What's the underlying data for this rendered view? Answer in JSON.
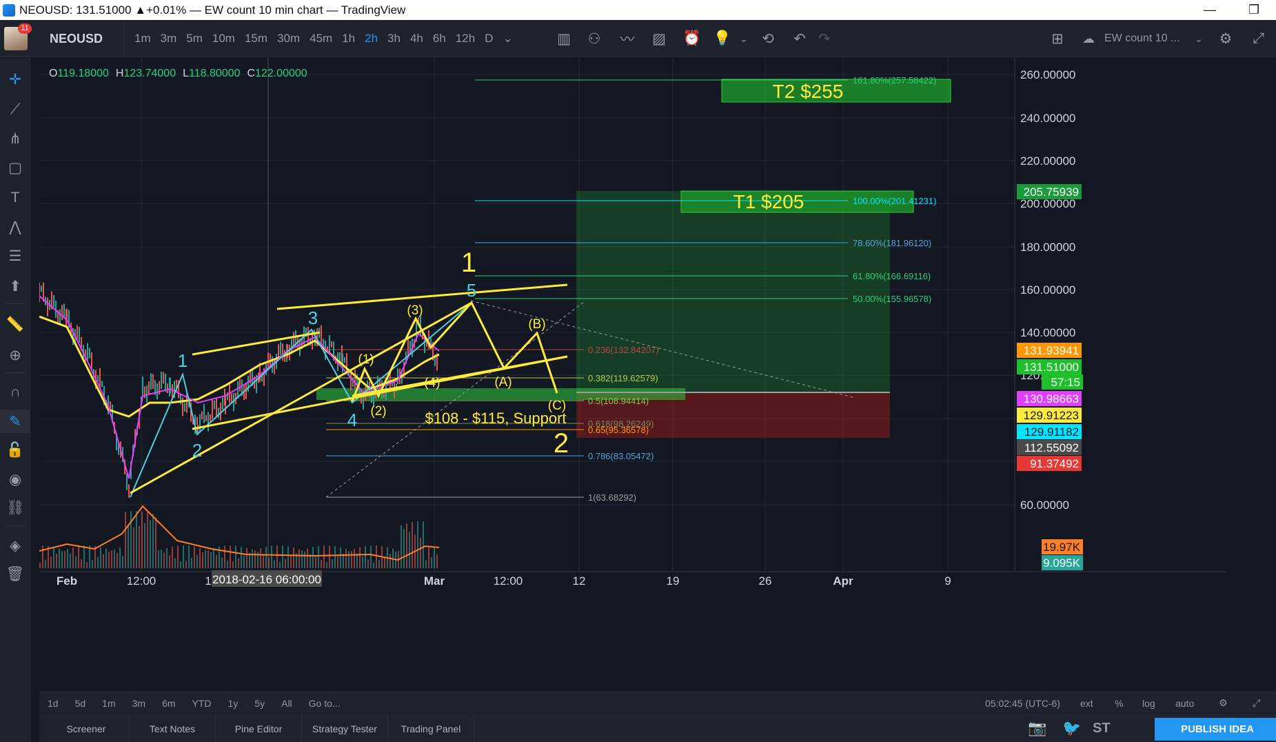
{
  "window": {
    "title": "NEOUSD: 131.51000 ▲+0.01% — EW count 10 min chart — TradingView",
    "minimize": "—",
    "restore": "❐"
  },
  "toolbar": {
    "avatar_badge": "11",
    "symbol": "NEOUSD",
    "intervals": [
      "1m",
      "3m",
      "5m",
      "10m",
      "15m",
      "30m",
      "45m",
      "1h",
      "2h",
      "3h",
      "4h",
      "6h",
      "12h",
      "D"
    ],
    "active_interval": "2h",
    "layout_name": "EW count 10 ...",
    "dropdown": "⌄"
  },
  "ohlc": {
    "o_label": "O",
    "o": "119.18000",
    "h_label": "H",
    "h": "123.74000",
    "l_label": "L",
    "l": "118.80000",
    "c_label": "C",
    "c": "122.00000"
  },
  "price_axis": {
    "ticks": [
      "260.00000",
      "240.00000",
      "220.00000",
      "200.00000",
      "180.00000",
      "160.00000",
      "140.00000",
      "120.",
      "60.00000"
    ],
    "labels": [
      {
        "text": "205.75939",
        "bg": "#1a9a3a",
        "fg": "#ffffff"
      },
      {
        "text": "131.93941",
        "bg": "#ff9800",
        "fg": "#ffffff"
      },
      {
        "text": "131.51000",
        "bg": "#1fbf2c",
        "fg": "#ffffff"
      },
      {
        "text": "57:15",
        "bg": "#1fbf2c",
        "fg": "#ffffff"
      },
      {
        "text": "130.98663",
        "bg": "#e040fb",
        "fg": "#ffffff"
      },
      {
        "text": "129.91223",
        "bg": "#ffeb3b",
        "fg": "#131722"
      },
      {
        "text": "129.91182",
        "bg": "#00e5ff",
        "fg": "#131722"
      },
      {
        "text": "112.55092",
        "bg": "#4a4a4a",
        "fg": "#ffffff"
      },
      {
        "text": "91.37492",
        "bg": "#e53935",
        "fg": "#ffffff"
      },
      {
        "text": "19.97K",
        "bg": "#ff7f27",
        "fg": "#131722"
      },
      {
        "text": "9.095K",
        "bg": "#26a69a",
        "fg": "#ffffff"
      }
    ]
  },
  "time_axis": {
    "ticks": [
      "Feb",
      "12:00",
      "1",
      "Mar",
      "12:00",
      "12",
      "19",
      "26",
      "Apr",
      "9"
    ],
    "crosshair_label": "2018-02-16 06:00:00"
  },
  "annotations": {
    "t2": "T2 $255",
    "t1": "T1 $205",
    "support": "$108 - $115, Support",
    "wave_major_1": "1",
    "wave_major_2": "2",
    "wave_labels_cyan": [
      "1",
      "2",
      "3",
      "4",
      "5"
    ],
    "wave_labels_sub": [
      "(1)",
      "(2)",
      "(3)",
      "(4)",
      "(A)",
      "(B)",
      "(C)"
    ]
  },
  "fib_levels": [
    {
      "text": "161.80%(257.58422)",
      "color": "#26d07c"
    },
    {
      "text": "100.00%(201.41231)",
      "color": "#00e5ff"
    },
    {
      "text": "78.60%(181.96120)",
      "color": "#4fa3d9"
    },
    {
      "text": "61.80%(166.69116)",
      "color": "#26d07c"
    },
    {
      "text": "50.00%(155.96578)",
      "color": "#26d07c"
    },
    {
      "text": "0.236(132.84207)",
      "color": "#b94a48"
    },
    {
      "text": "0.382(119.62579)",
      "color": "#b5c94e"
    },
    {
      "text": "0.5(108.94414)",
      "color": "#8bc34a"
    },
    {
      "text": "0.618(98.26249)",
      "color": "#7a8a5a"
    },
    {
      "text": "0.65(95.36578)",
      "color": "#ff9800"
    },
    {
      "text": "0.786(83.05472)",
      "color": "#4fa3d9"
    },
    {
      "text": "1(63.68292)",
      "color": "#9e9e9e"
    }
  ],
  "rangebar": {
    "ranges": [
      "1d",
      "5d",
      "1m",
      "3m",
      "6m",
      "YTD",
      "1y",
      "5y",
      "All"
    ],
    "goto": "Go to...",
    "clock": "05:02:45 (UTC-6)",
    "ext": "ext",
    "percent": "%",
    "log": "log",
    "auto": "auto"
  },
  "panels": {
    "tabs": [
      "Screener",
      "Text Notes",
      "Pine Editor",
      "Strategy Tester",
      "Trading Panel"
    ],
    "st_label": "ST",
    "publish": "PUBLISH IDEA"
  },
  "colors": {
    "background": "#131722",
    "wave_yellow": "#ffeb3b",
    "wave_cyan": "#4dd0e1",
    "target_box": "#1f8f2a",
    "accent": "#2196f3"
  }
}
